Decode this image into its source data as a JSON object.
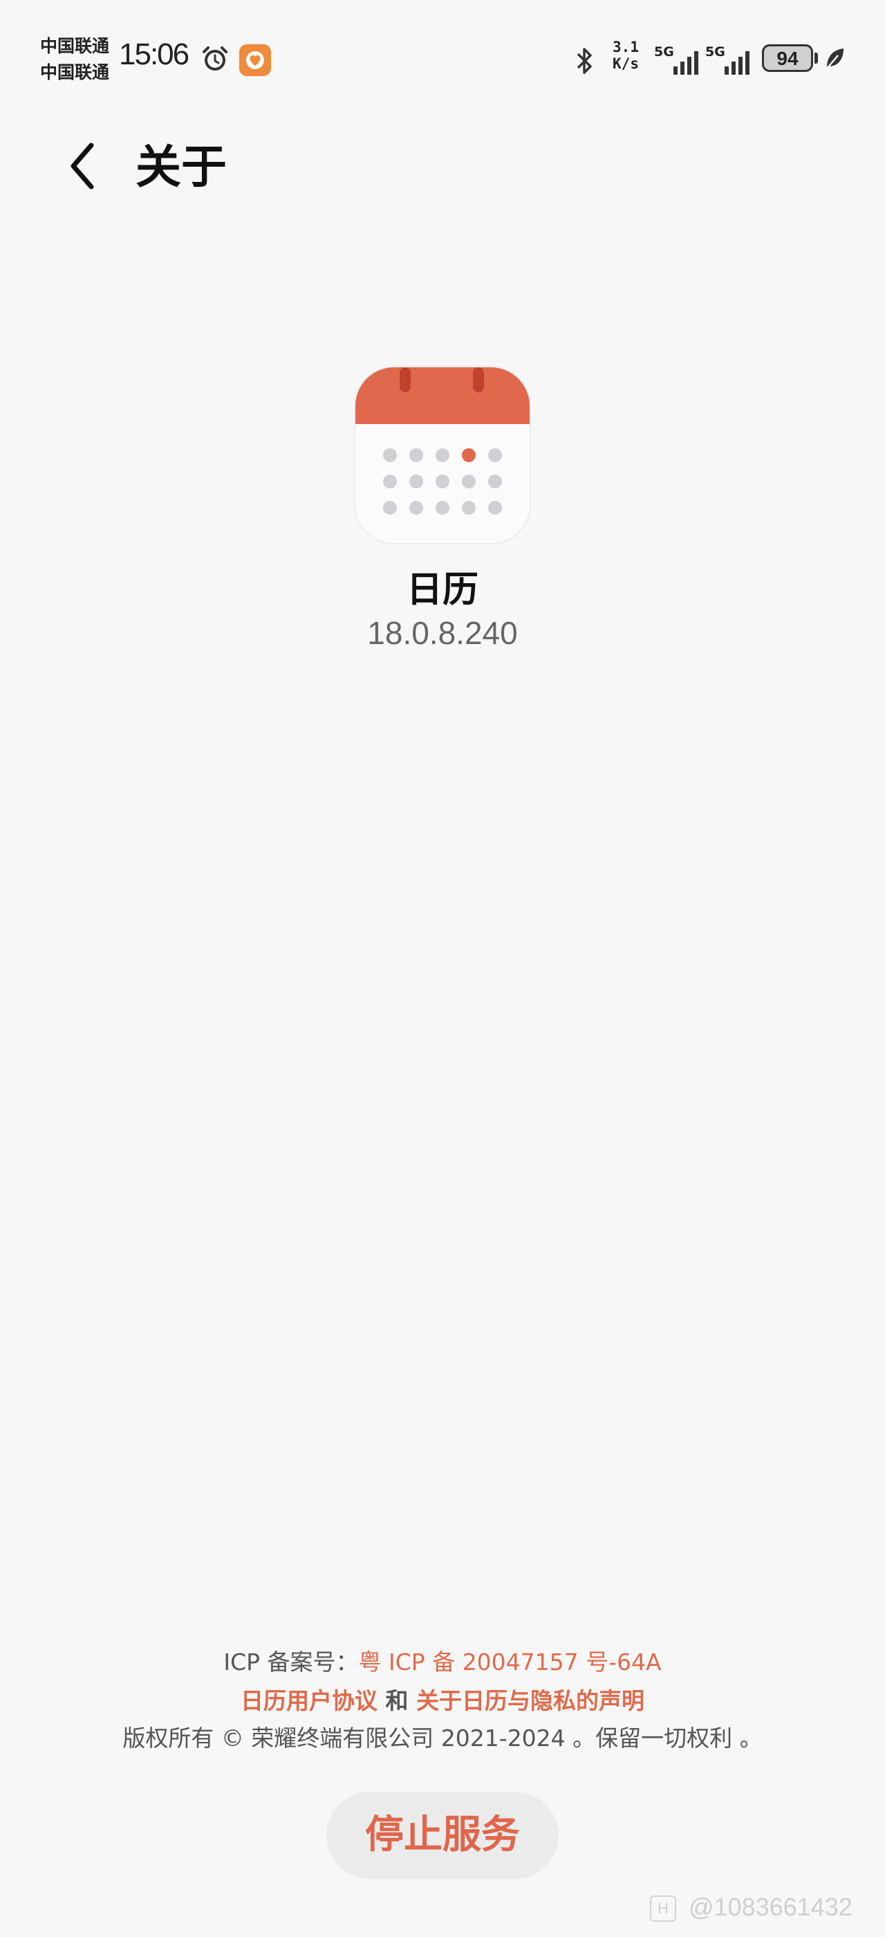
{
  "status_bar": {
    "carriers": [
      "中国联通",
      "中国联通"
    ],
    "time": "15:06",
    "net_speed": {
      "value": "3.1",
      "unit": "K/s"
    },
    "signals": [
      {
        "tech": "5G",
        "level": 4
      },
      {
        "tech": "5G",
        "level": 4
      }
    ],
    "battery": "94",
    "icons": [
      "alarm-icon",
      "health-app-icon",
      "bluetooth-icon",
      "battery-icon",
      "leaf-icon"
    ]
  },
  "header": {
    "title": "关于",
    "back_icon": "chevron-left-icon"
  },
  "app": {
    "name": "日历",
    "version": "18.0.8.240",
    "icon": "calendar-icon",
    "colors": {
      "accent": "#e06a4b",
      "icon_header": "#e0684c"
    }
  },
  "footer": {
    "icp_label": "ICP 备案号：",
    "icp_number": "粤 ICP 备 20047157 号-64A",
    "agreement_link": "日历用户协议",
    "conjunction": " 和 ",
    "privacy_link": "关于日历与隐私的声明",
    "copyright": "版权所有 © 荣耀终端有限公司 2021-2024 。保留一切权利 。",
    "stop_service": "停止服务"
  },
  "watermark": {
    "logo": "H",
    "text": "@1083661432"
  }
}
